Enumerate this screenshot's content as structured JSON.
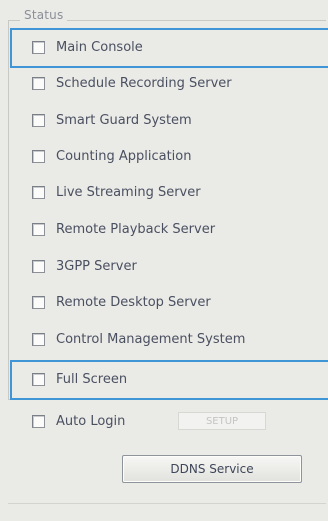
{
  "group": {
    "label": "Status"
  },
  "checkboxes": [
    {
      "label": "Main Console",
      "checked": false
    },
    {
      "label": "Schedule Recording Server",
      "checked": false
    },
    {
      "label": "Smart Guard System",
      "checked": false
    },
    {
      "label": "Counting Application",
      "checked": false
    },
    {
      "label": "Live Streaming Server",
      "checked": false
    },
    {
      "label": "Remote Playback Server",
      "checked": false
    },
    {
      "label": "3GPP Server",
      "checked": false
    },
    {
      "label": "Remote Desktop Server",
      "checked": false
    },
    {
      "label": "Control Management System",
      "checked": false
    },
    {
      "label": "Full Screen",
      "checked": false
    },
    {
      "label": "Auto Login",
      "checked": false
    }
  ],
  "auto_login_field": {
    "value": "SETUP"
  },
  "ddns_button": {
    "label": "DDNS Service"
  },
  "colors": {
    "highlight": "#3f95d6",
    "background": "#eaeae7"
  }
}
